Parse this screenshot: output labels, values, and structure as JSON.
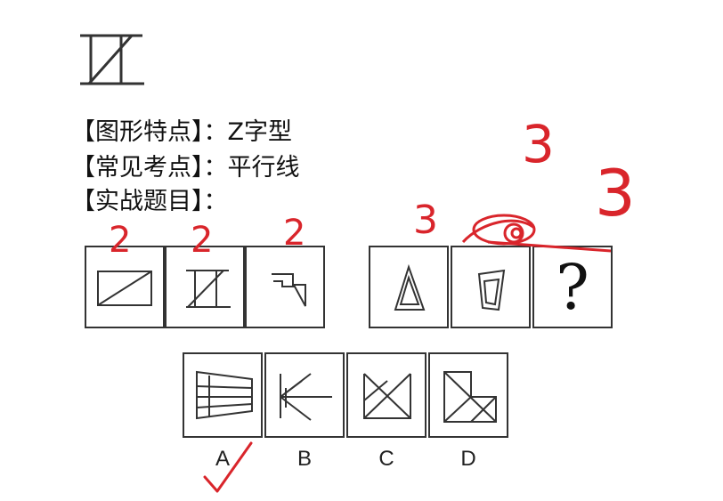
{
  "heading_lines": [
    "【图形特点】：Z字型",
    "【常见考点】：平行线",
    "【实战题目】："
  ],
  "question_mark": "?",
  "option_labels": [
    "A",
    "B",
    "C",
    "D"
  ],
  "annotations": {
    "counts_left": [
      "2",
      "2",
      "2"
    ],
    "counts_right": [
      "3",
      "3",
      "3"
    ],
    "answer_mark": "✓",
    "ink_color": "#d9252b"
  }
}
